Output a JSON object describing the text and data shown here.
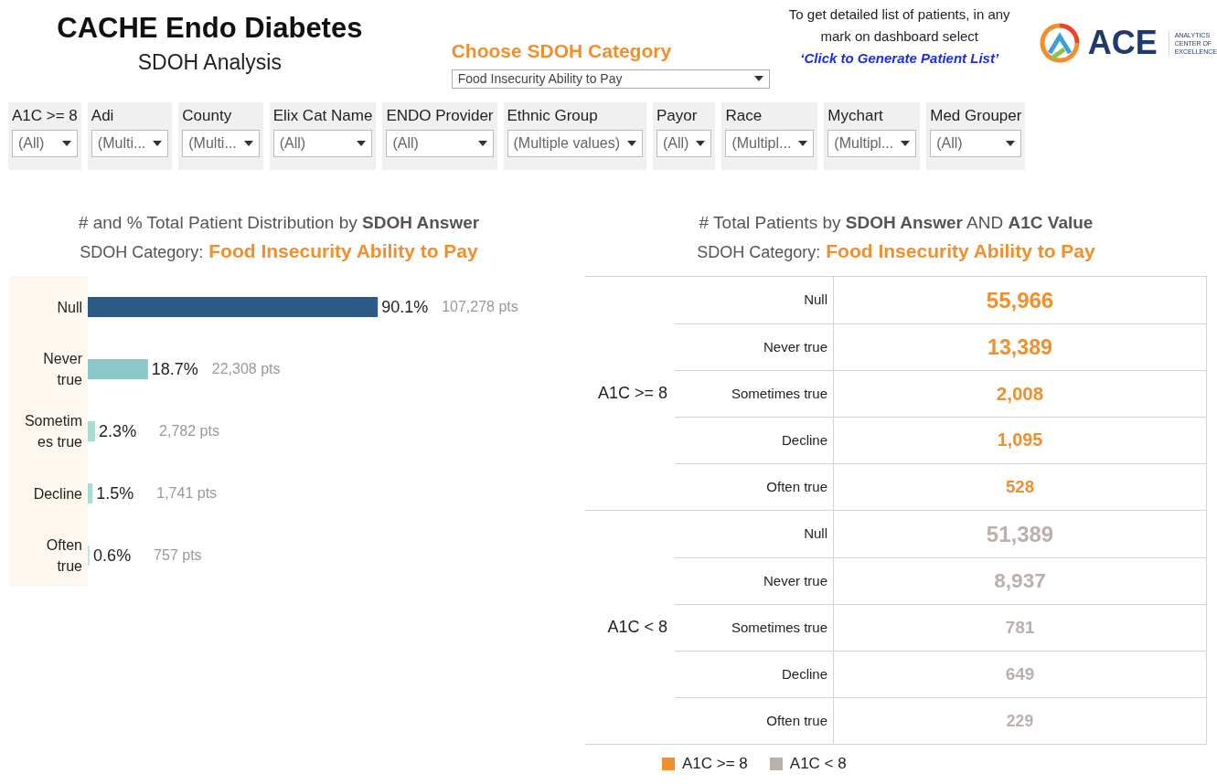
{
  "header": {
    "title": "CACHE Endo Diabetes",
    "subtitle": "SDOH Analysis"
  },
  "category_picker": {
    "label": "Choose SDOH Category",
    "value": "Food Insecurity Ability to Pay"
  },
  "instructions": {
    "text": "To get detailed list of patients, in any mark on dashboard select",
    "link": "‘Click to Generate Patient List’"
  },
  "logo": {
    "name": "ACE",
    "tagline": [
      "ANALYTICS",
      "CENTER OF",
      "EXCELLENCE"
    ]
  },
  "filters": [
    {
      "label": "A1C >= 8",
      "value": "(All)"
    },
    {
      "label": "Adi",
      "value": "(Multi..."
    },
    {
      "label": "County",
      "value": "(Multi..."
    },
    {
      "label": "Elix Cat Name",
      "value": "(All)"
    },
    {
      "label": "ENDO Provider",
      "value": "(All)"
    },
    {
      "label": "Ethnic Group",
      "value": "(Multiple values)"
    },
    {
      "label": "Payor",
      "value": "(All)"
    },
    {
      "label": "Race",
      "value": "(Multipl..."
    },
    {
      "label": "Mychart",
      "value": "(Multipl..."
    },
    {
      "label": "Med Grouper",
      "value": "(All)"
    }
  ],
  "distribution": {
    "title": "# and % Total Patient Distribution by **SDOH Answer**",
    "category_label": "SDOH Category:",
    "category_value": "Food Insecurity Ability to Pay",
    "chart_data": {
      "type": "bar",
      "orientation": "horizontal",
      "categories": [
        "Null",
        "Never true",
        "Sometimes true",
        "Decline",
        "Often true"
      ],
      "series": [
        {
          "values": [
            90.1,
            18.7,
            2.3,
            1.5,
            0.6
          ]
        }
      ],
      "data_labels": true
    },
    "label_suffix": "%",
    "bars": [
      {
        "color": "#2c5a87",
        "points": "107,278 pts"
      },
      {
        "color": "#8cc8ca",
        "points": "22,308 pts"
      },
      {
        "color": "#a9dcd3",
        "points": "2,782 pts"
      },
      {
        "color": "#a9dcd3",
        "points": "1,741 pts"
      },
      {
        "color": "#c4e8e0",
        "points": "757 pts"
      }
    ]
  },
  "crosstab": {
    "title": "# Total Patients by **SDOH Answer** AND **A1C Value**",
    "category_label": "SDOH Category:",
    "category_value": "Food Insecurity Ability to Pay",
    "groups": [
      {
        "label": "A1C >= 8",
        "color": "#f28e2b",
        "rows": [
          {
            "answer": "Null",
            "count": "55,966"
          },
          {
            "answer": "Never true",
            "count": "13,389"
          },
          {
            "answer": "Sometimes true",
            "count": "2,008"
          },
          {
            "answer": "Decline",
            "count": "1,095"
          },
          {
            "answer": "Often true",
            "count": "528"
          }
        ]
      },
      {
        "label": "A1C < 8",
        "color": "#bab0ac",
        "rows": [
          {
            "answer": "Null",
            "count": "51,389"
          },
          {
            "answer": "Never true",
            "count": "8,937"
          },
          {
            "answer": "Sometimes true",
            "count": "781"
          },
          {
            "answer": "Decline",
            "count": "649"
          },
          {
            "answer": "Often true",
            "count": "229"
          }
        ]
      }
    ],
    "legend": [
      {
        "label": "A1C >= 8",
        "color": "#f28e2b"
      },
      {
        "label": "A1C < 8",
        "color": "#bab0ac"
      }
    ]
  }
}
